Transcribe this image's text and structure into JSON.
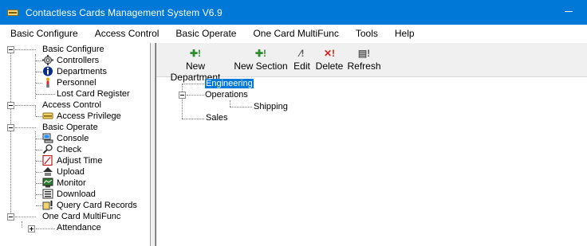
{
  "window": {
    "title": "Contactless Cards Management System  V6.9"
  },
  "menubar": {
    "items": [
      "Basic Configure",
      "Access Control",
      "Basic Operate",
      "One Card MultiFunc",
      "Tools",
      "Help"
    ]
  },
  "tree": {
    "basic_configure": {
      "label": "Basic Configure",
      "children": [
        "Controllers",
        "Departments",
        "Personnel",
        "Lost Card Register"
      ]
    },
    "access_control": {
      "label": "Access Control",
      "children": [
        "Access Privilege"
      ]
    },
    "basic_operate": {
      "label": "Basic Operate",
      "children": [
        "Console",
        "Check",
        "Adjust Time",
        "Upload",
        "Monitor",
        "Download",
        "Query Card Records"
      ]
    },
    "one_card": {
      "label": "One Card MultiFunc",
      "children": [
        "Attendance"
      ]
    }
  },
  "toolbar": {
    "new_department": "New Department",
    "new_section": "New Section",
    "edit": "Edit",
    "delete": "Delete",
    "refresh": "Refresh"
  },
  "departments": {
    "engineering": "Engineering",
    "operations": "Operations",
    "shipping": "Shipping",
    "sales": "Sales"
  },
  "colors": {
    "titlebar": "#0078d7",
    "selection": "#0078d7"
  }
}
